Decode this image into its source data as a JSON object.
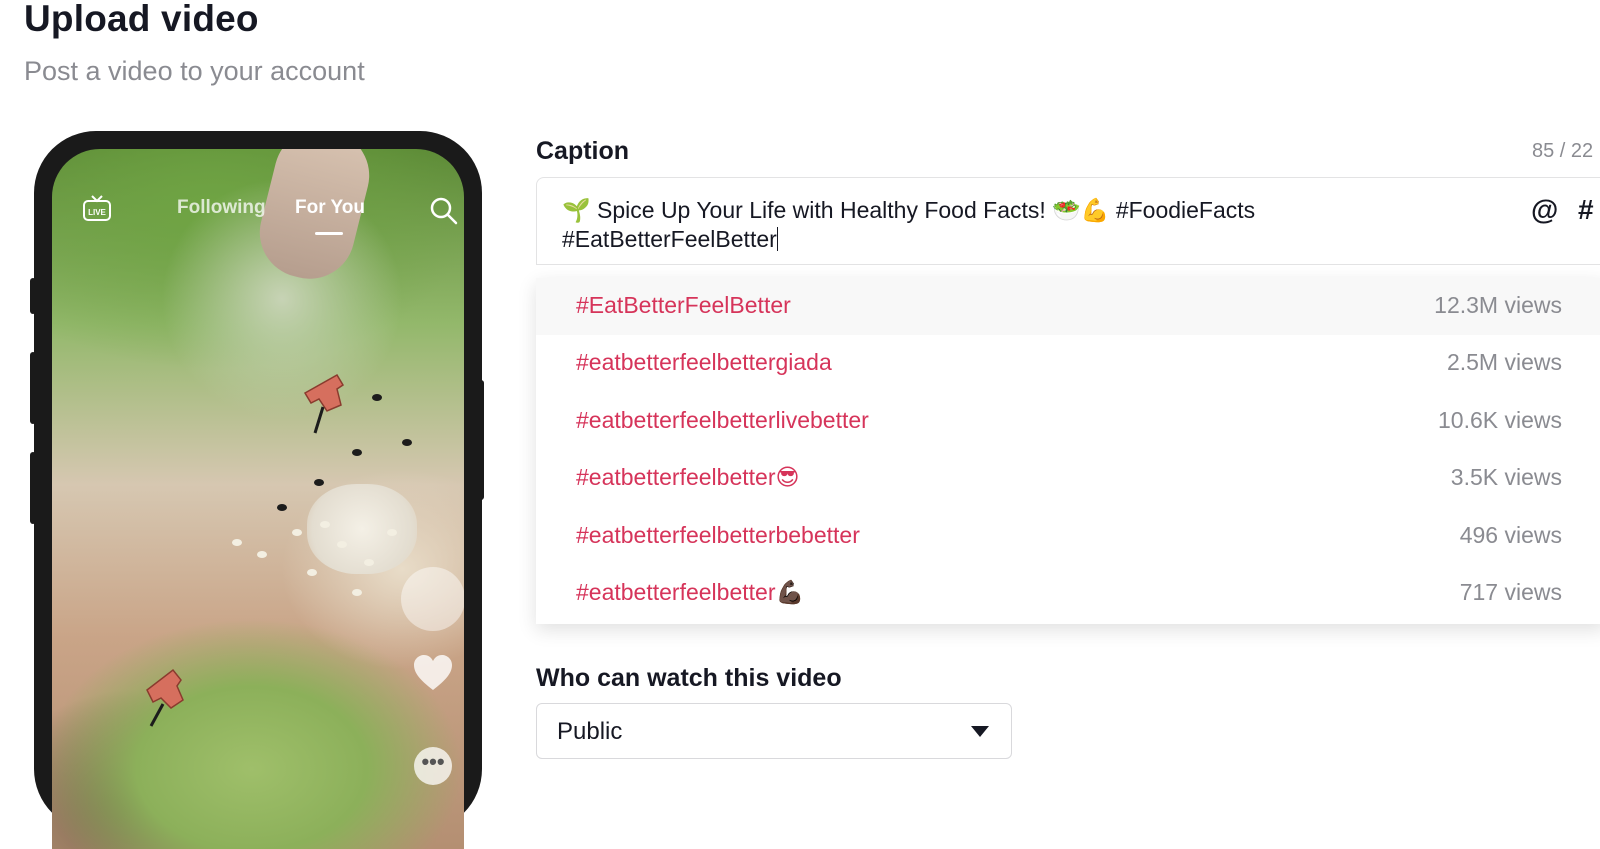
{
  "header": {
    "title": "Upload video",
    "subtitle": "Post a video to your account"
  },
  "preview": {
    "live_label": "LIVE",
    "tab_following": "Following",
    "tab_for_you": "For You",
    "active_tab": "For You"
  },
  "caption": {
    "label": "Caption",
    "char_count": "85 / 22",
    "line1": "🌱 Spice Up Your Life with Healthy Food Facts! 🥗💪 #FoodieFacts",
    "line2": "#EatBetterFeelBetter",
    "mention_button": "@",
    "hashtag_button": "#"
  },
  "suggestions": [
    {
      "tag": "#EatBetterFeelBetter",
      "views": "12.3M views",
      "active": true
    },
    {
      "tag": "#eatbetterfeelbettergiada",
      "views": "2.5M views"
    },
    {
      "tag": "#eatbetterfeelbetterlivebetter",
      "views": "10.6K views"
    },
    {
      "tag": "#eatbetterfeelbetter😎",
      "views": "3.5K views"
    },
    {
      "tag": "#eatbetterfeelbetterbebetter",
      "views": "496 views"
    },
    {
      "tag": "#eatbetterfeelbetter💪🏿",
      "views": "717 views"
    }
  ],
  "privacy": {
    "label": "Who can watch this video",
    "selected": "Public"
  },
  "colors": {
    "hashtag": "#d6345a",
    "muted": "#8a8b91",
    "text": "#161823"
  }
}
